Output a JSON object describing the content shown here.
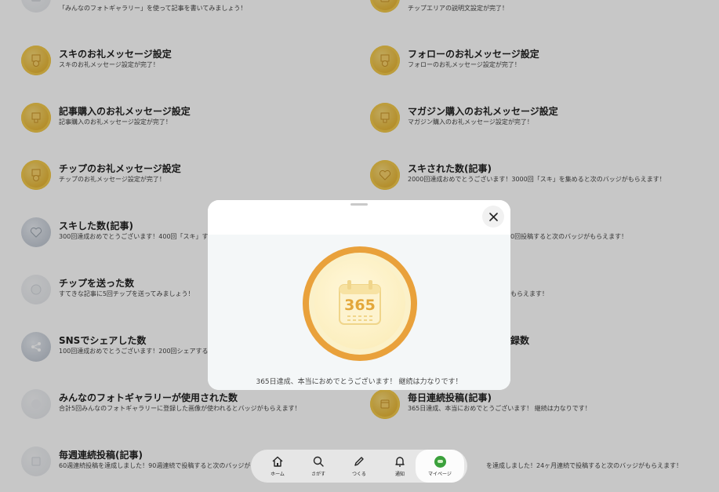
{
  "badges": [
    {
      "title": "",
      "desc": "「みんなのフォトギャラリー」を使って記事を書いてみましょう！",
      "color": "pale",
      "icon": "photo-gallery-icon"
    },
    {
      "title": "",
      "desc": "チップエリアの説明文設定が完了！",
      "color": "gold",
      "icon": "tip-area-icon"
    },
    {
      "title": "スキのお礼メッセージ設定",
      "desc": "スキのお礼メッセージ設定が完了！",
      "color": "gold",
      "icon": "heart-medal-icon"
    },
    {
      "title": "フォローのお礼メッセージ設定",
      "desc": "フォローのお礼メッセージ設定が完了！",
      "color": "gold",
      "icon": "follow-medal-icon"
    },
    {
      "title": "記事購入のお礼メッセージ設定",
      "desc": "記事購入のお礼メッセージ設定が完了！",
      "color": "gold",
      "icon": "article-purchase-icon"
    },
    {
      "title": "マガジン購入のお礼メッセージ設定",
      "desc": "マガジン購入のお礼メッセージ設定が完了！",
      "color": "gold",
      "icon": "magazine-purchase-icon"
    },
    {
      "title": "チップのお礼メッセージ設定",
      "desc": "チップのお礼メッセージ設定が完了！",
      "color": "gold",
      "icon": "tip-medal-icon"
    },
    {
      "title": "スキされた数(記事)",
      "desc": "2000回達成おめでとうございます！3000回「スキ」を集めると次のバッジがもらえます！",
      "color": "gold",
      "icon": "heart-icon"
    },
    {
      "title": "スキした数(記事)",
      "desc": "300回達成おめでとうございます！400回「スキ」すると",
      "color": "silver",
      "icon": "heart-icon"
    },
    {
      "title": "",
      "desc": "0回投稿すると次のバッジがもらえます！",
      "color": "none",
      "icon": ""
    },
    {
      "title": "チップを送った数",
      "desc": "すてきな記事に5回チップを送ってみましょう！",
      "color": "pale",
      "icon": "coin-icon"
    },
    {
      "title": "",
      "desc": "もらえます！",
      "color": "none",
      "icon": ""
    },
    {
      "title": "SNSでシェアした数",
      "desc": "100回達成おめでとうございます！200回シェアすると",
      "color": "silver",
      "icon": "share-icon"
    },
    {
      "title": "録数",
      "desc": "",
      "color": "none",
      "icon": ""
    },
    {
      "title": "みんなのフォトギャラリーが使用された数",
      "desc": "合計5回みんなのフォトギャラリーに登録した画像が使われるとバッジがもらえます！",
      "color": "pale",
      "icon": "photo-gallery-icon"
    },
    {
      "title": "毎日連続投稿(記事)",
      "desc": "365日達成、本当におめでとうございます！ 継続は力なりです！",
      "color": "gold",
      "icon": "calendar-icon"
    },
    {
      "title": "毎週連続投稿(記事)",
      "desc": "60週連続投稿を達成しました！90週連続で投稿すると次のバッジが",
      "color": "pale",
      "icon": "calendar-week-icon"
    },
    {
      "title": "",
      "desc": "を達成しました！24ヶ月連続で投稿すると次のバッジがもらえます！",
      "color": "none",
      "icon": ""
    }
  ],
  "modal": {
    "badge_number": "365",
    "message": "365日達成、本当におめでとうございます！ 継続は力なりです！"
  },
  "nav": {
    "home": "ホーム",
    "search": "さがす",
    "create": "つくる",
    "notify": "通知",
    "mypage": "マイページ"
  },
  "colors": {
    "gold": "#e8b93c",
    "medal_ring": "#e9a13b",
    "overlay": "rgba(0,0,0,0.22)"
  }
}
